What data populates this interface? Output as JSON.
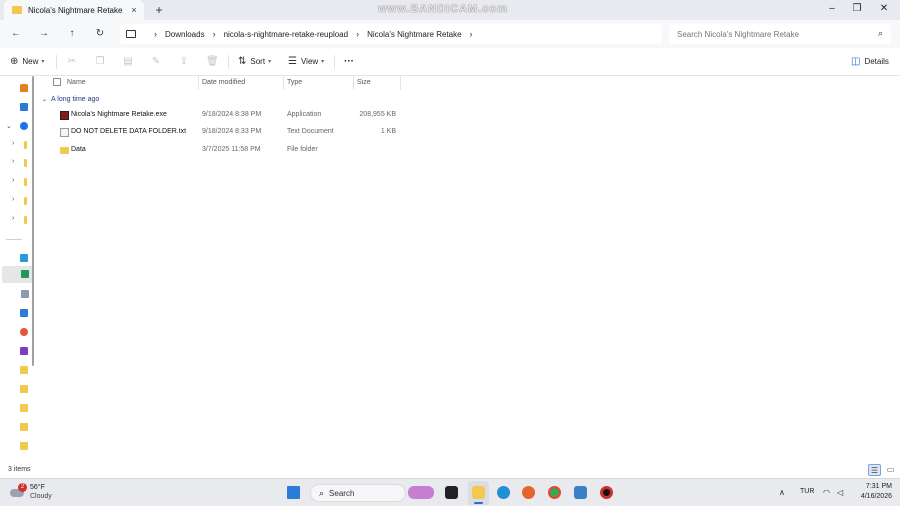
{
  "window": {
    "tab_title": "Nicola's Nightmare Retake",
    "tab_close": "×",
    "new_tab": "+",
    "watermark": "www.BANDICAM.com",
    "minimize": "–",
    "maximize": "❐",
    "close": "✕"
  },
  "nav": {
    "back": "←",
    "forward": "→",
    "up": "↑",
    "refresh": "↻"
  },
  "breadcrumb": [
    "Downloads",
    "nicola-s-nightmare-retake-reupload",
    "Nicola's Nightmare Retake"
  ],
  "search": {
    "placeholder": "Search Nicola's Nightmare Retake"
  },
  "commands": {
    "new_label": "New",
    "sort_label": "Sort",
    "view_label": "View",
    "more_label": "···",
    "details_label": "Details"
  },
  "columns": [
    "Name",
    "Date modified",
    "Type",
    "Size"
  ],
  "group_label": "A long time ago",
  "files": [
    {
      "name": "Nicola's Nightmare Retake.exe",
      "date": "9/18/2024 8:38 PM",
      "type": "Application",
      "size": "208,955 KB",
      "icon": "app-icon",
      "color": "#8b1a1a"
    },
    {
      "name": "DO NOT DELETE DATA FOLDER.txt",
      "date": "9/18/2024 8:33 PM",
      "type": "Text Document",
      "size": "1 KB",
      "icon": "text-file-icon",
      "color": "#e0e0e0"
    },
    {
      "name": "Data",
      "date": "3/7/2025 11:58 PM",
      "type": "File folder",
      "size": "",
      "icon": "folder-icon",
      "color": "#f2c94c"
    }
  ],
  "status": {
    "items_count": "3 items"
  },
  "taskbar": {
    "weather_badge": "2",
    "temperature": "56°F",
    "condition": "Cloudy",
    "search_label": "Search",
    "language": "TUR",
    "time": "7:31 PM",
    "date": "4/16/2026"
  }
}
